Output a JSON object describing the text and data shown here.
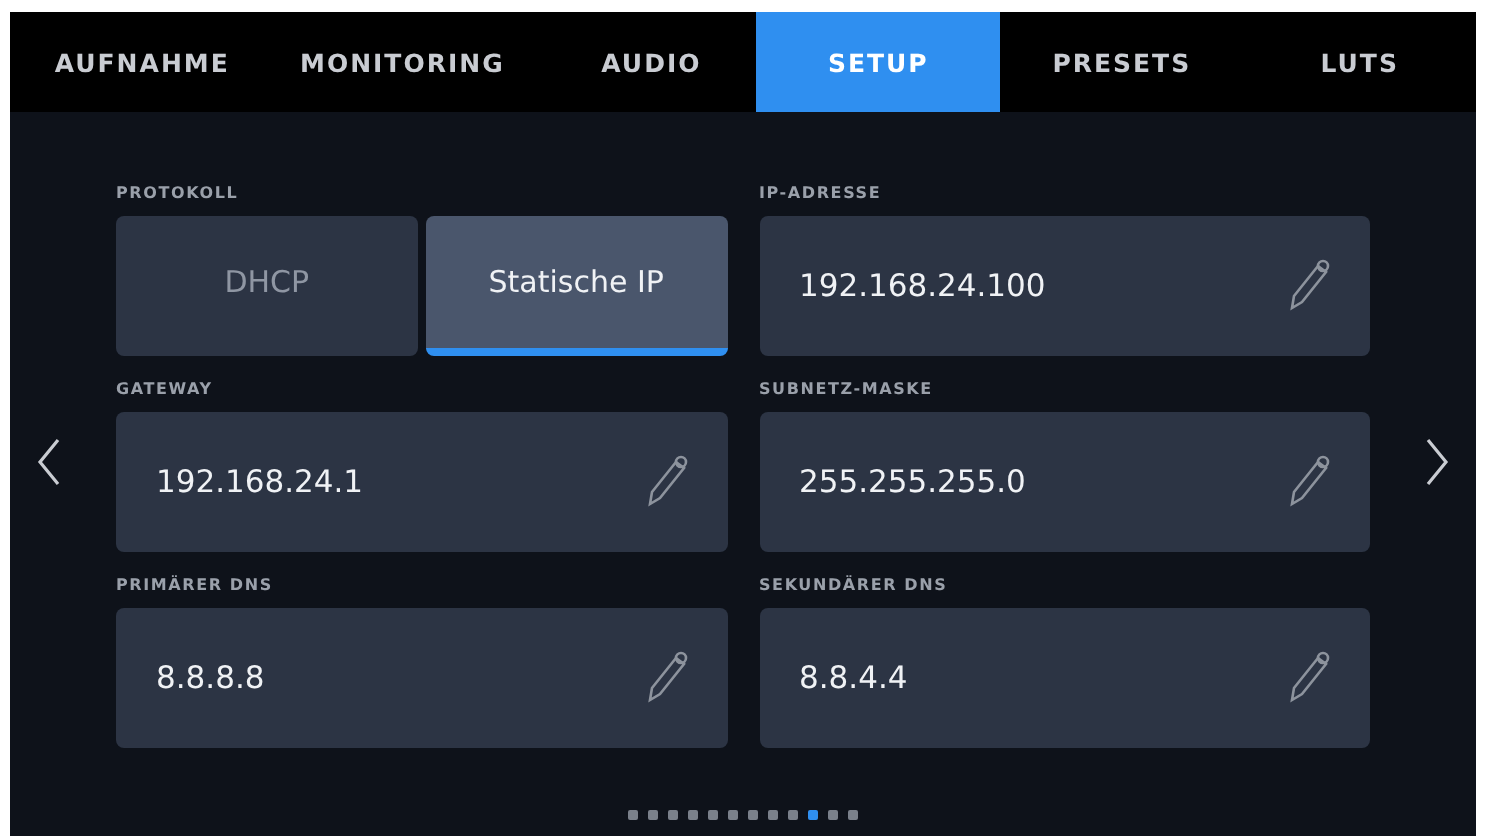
{
  "tabs": [
    {
      "label": "AUFNAHME",
      "selected": false
    },
    {
      "label": "MONITORING",
      "selected": false
    },
    {
      "label": "AUDIO",
      "selected": false
    },
    {
      "label": "SETUP",
      "selected": true
    },
    {
      "label": "PRESETS",
      "selected": false
    },
    {
      "label": "LUTS",
      "selected": false
    }
  ],
  "protocol": {
    "label": "PROTOKOLL",
    "options": [
      {
        "label": "DHCP",
        "selected": false
      },
      {
        "label": "Statische IP",
        "selected": true
      }
    ]
  },
  "fields": [
    {
      "label": "IP-ADRESSE",
      "value": "192.168.24.100"
    },
    {
      "label": "GATEWAY",
      "value": "192.168.24.1"
    },
    {
      "label": "SUBNETZ-MASKE",
      "value": "255.255.255.0"
    },
    {
      "label": "PRIMÄRER DNS",
      "value": "8.8.8.8"
    },
    {
      "label": "SEKUNDÄRER DNS",
      "value": "8.8.4.4"
    }
  ],
  "pages": [
    {
      "selected": false
    },
    {
      "selected": false
    },
    {
      "selected": false
    },
    {
      "selected": false
    },
    {
      "selected": false
    },
    {
      "selected": false
    },
    {
      "selected": false
    },
    {
      "selected": false
    },
    {
      "selected": false
    },
    {
      "selected": true
    },
    {
      "selected": false
    },
    {
      "selected": false
    }
  ]
}
